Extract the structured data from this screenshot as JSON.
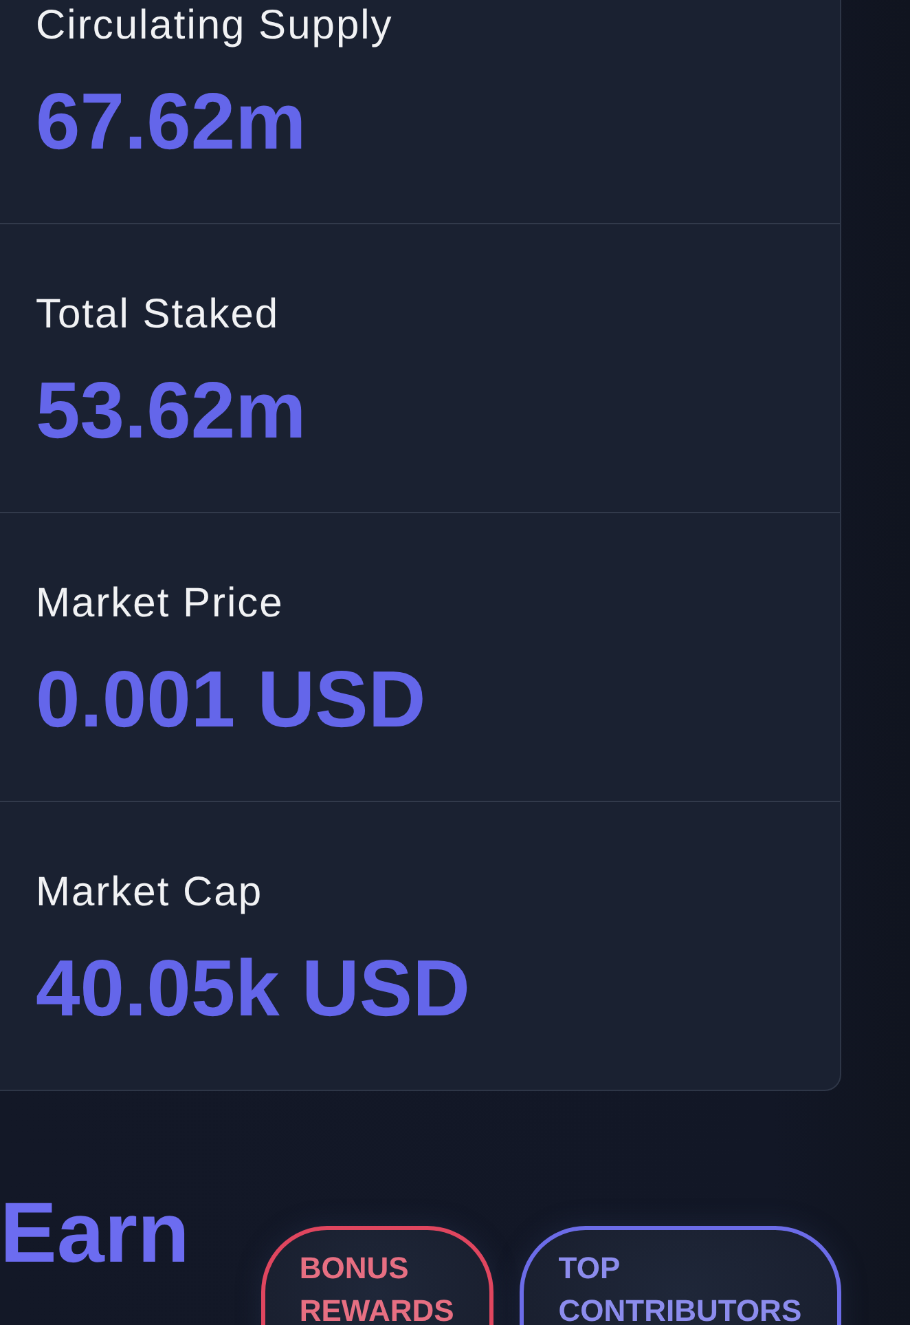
{
  "stats": [
    {
      "label": "Circulating Supply",
      "value": "67.62m"
    },
    {
      "label": "Total Staked",
      "value": "53.62m"
    },
    {
      "label": "Market Price",
      "value": "0.001 USD"
    },
    {
      "label": "Market Cap",
      "value": "40.05k USD"
    }
  ],
  "earn": {
    "heading": "Earn",
    "badges": [
      {
        "label": "BONUS REWARDS",
        "color": "#e0465f"
      },
      {
        "label": "TOP CONTRIBUTORS",
        "color": "#6c6ce8"
      }
    ]
  }
}
